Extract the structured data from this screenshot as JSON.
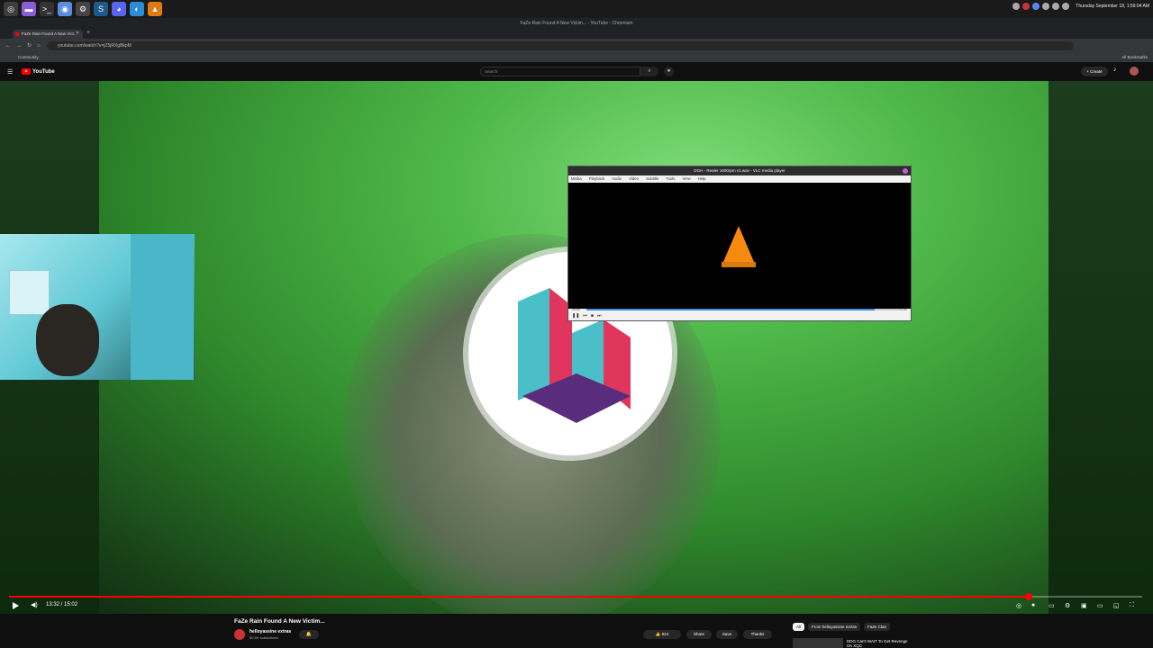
{
  "os_panel": {
    "apps": [
      {
        "name": "mint-menu-icon",
        "color": "#3d3d3d",
        "glyph": "◎"
      },
      {
        "name": "files-icon",
        "color": "#8a5cd6",
        "glyph": "▬"
      },
      {
        "name": "terminal-icon",
        "color": "#333",
        "glyph": ">_"
      },
      {
        "name": "chromium-icon",
        "color": "#5a8de0",
        "glyph": "◉"
      },
      {
        "name": "settings-icon",
        "color": "#444",
        "glyph": "⚙"
      },
      {
        "name": "steam-icon",
        "color": "#1b5a8a",
        "glyph": "S"
      },
      {
        "name": "discord-icon",
        "color": "#5865f2",
        "glyph": "◕"
      },
      {
        "name": "browser-icon",
        "color": "#2e8bd8",
        "glyph": "◐"
      },
      {
        "name": "vlc-taskbar-icon",
        "color": "#e07a10",
        "glyph": "▲"
      }
    ],
    "clock": "Thursday September 18, 1:59:04 AM"
  },
  "browser": {
    "window_title": "FaZe Rain Found A New Victim... - YouTube - Chromium",
    "tab_title": "FaZe Rain Found A New Vict...",
    "url": "youtube.com/watch?v=jZ5jRXgBkpM",
    "bookmark": "Community",
    "all_bookmarks": "All Bookmarks"
  },
  "youtube": {
    "logo_text": "YouTube",
    "search_placeholder": "Search",
    "create_label": "+ Create"
  },
  "vlc": {
    "title": "DGH - Realer 1600rpm v1.wav - VLC media player",
    "menu": [
      "Media",
      "Playback",
      "Audio",
      "Video",
      "Subtitle",
      "Tools",
      "View",
      "Help"
    ],
    "time_elapsed": "00:45",
    "time_total": "00:49",
    "progress_fraction": 0.92
  },
  "player": {
    "time": "13:32 / 15:02",
    "progress_fraction": 0.9
  },
  "video": {
    "title": "FaZe Rain Found A New Victim...",
    "channel": "helloyassine extras",
    "subscribers": "80.5K subscribers",
    "likes": "624",
    "share_label": "Share",
    "save_label": "Save",
    "thanks_label": "Thanks"
  },
  "recommendations": {
    "chips": [
      "All",
      "From helloyassine extras",
      "FaZe Clan"
    ],
    "first_title": "DDG Can't WAIT To Get Revenge On XQC"
  }
}
